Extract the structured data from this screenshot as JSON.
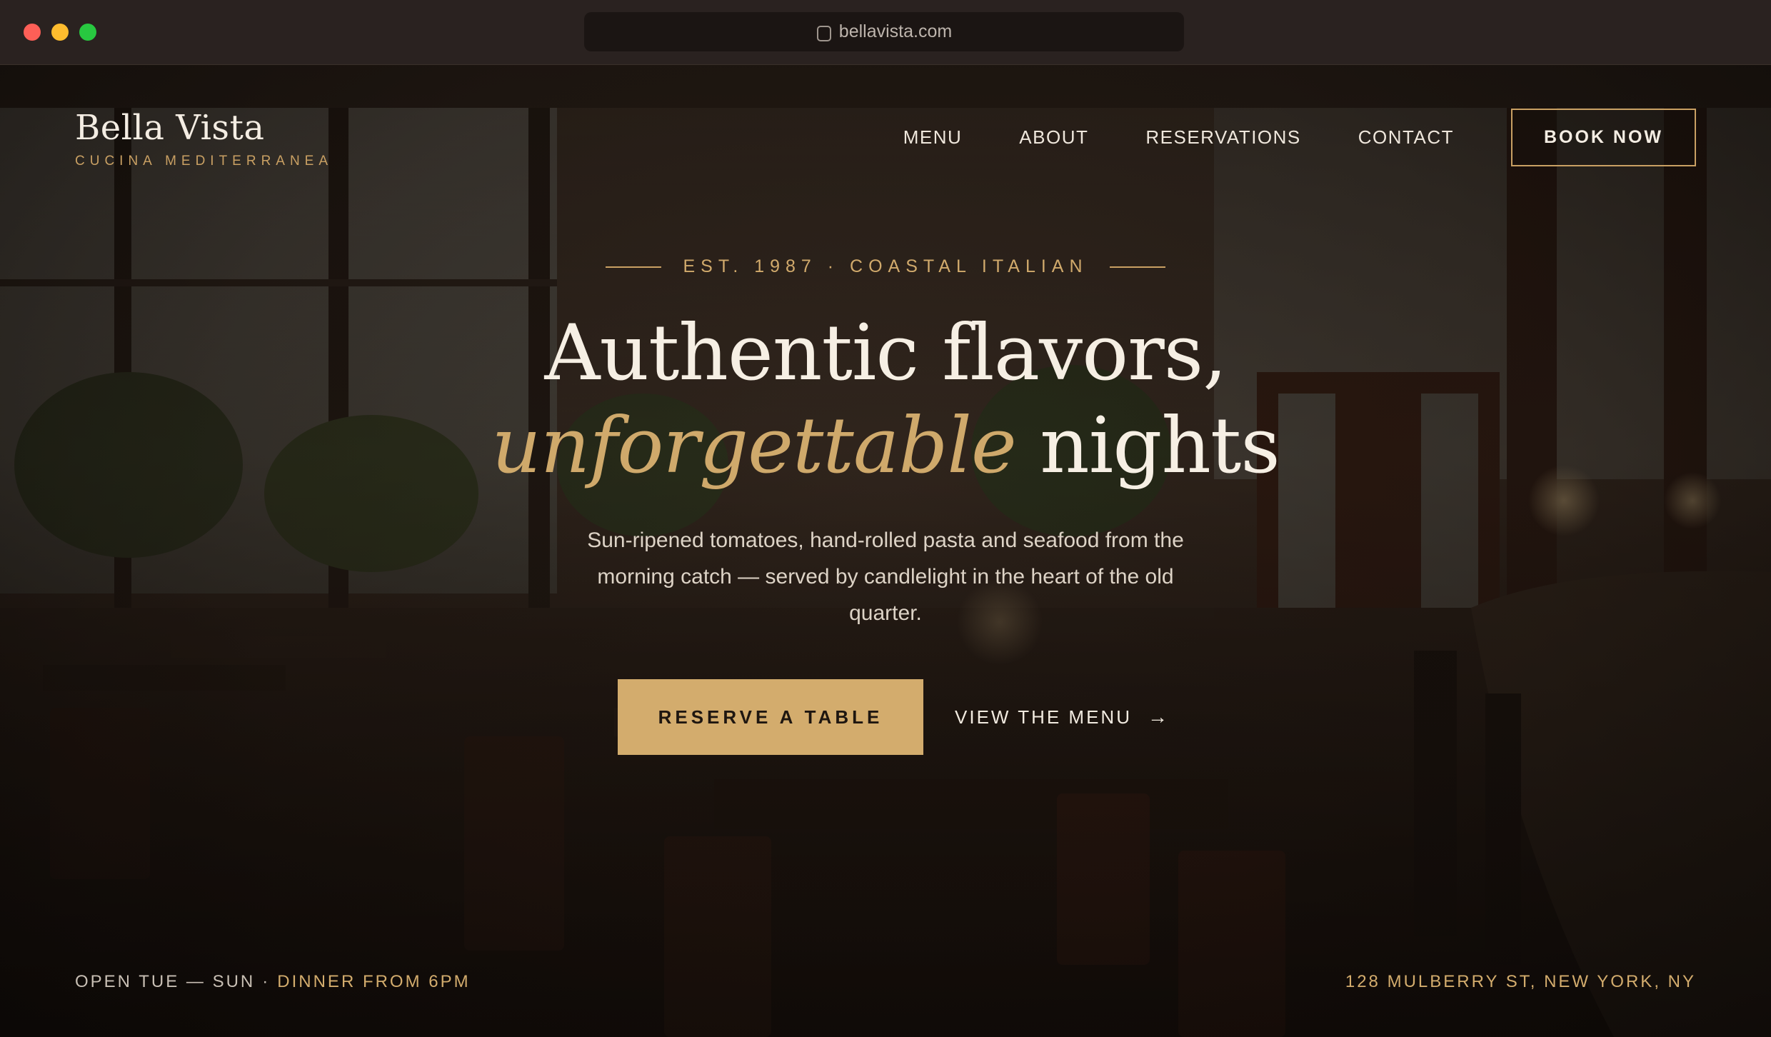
{
  "browser": {
    "url": "bellavista.com"
  },
  "brand": {
    "name": "Bella Vista",
    "tagline": "CUCINA MEDITERRANEA"
  },
  "nav": {
    "items": [
      "MENU",
      "ABOUT",
      "RESERVATIONS",
      "CONTACT"
    ],
    "cta": "BOOK NOW"
  },
  "hero": {
    "eyebrow": "EST. 1987 · COASTAL ITALIAN",
    "headline_line1": "Authentic flavors,",
    "headline_accent": "unforgettable",
    "headline_rest": "nights",
    "lede": "Sun-ripened tomatoes, hand-rolled pasta and seafood from the morning catch — served by candlelight in the heart of the old quarter.",
    "primary_cta": "RESERVE A TABLE",
    "secondary_cta": "VIEW THE MENU",
    "secondary_icon": "arrow-right-icon"
  },
  "footer": {
    "hours": "OPEN TUE — SUN",
    "separator": "·",
    "dinner": "DINNER FROM 6PM",
    "address": "128 MULBERRY ST, NEW YORK, NY"
  },
  "colors": {
    "accent": "#d3ac6d",
    "text": "#f4ede3",
    "chrome": "#2a2220"
  }
}
